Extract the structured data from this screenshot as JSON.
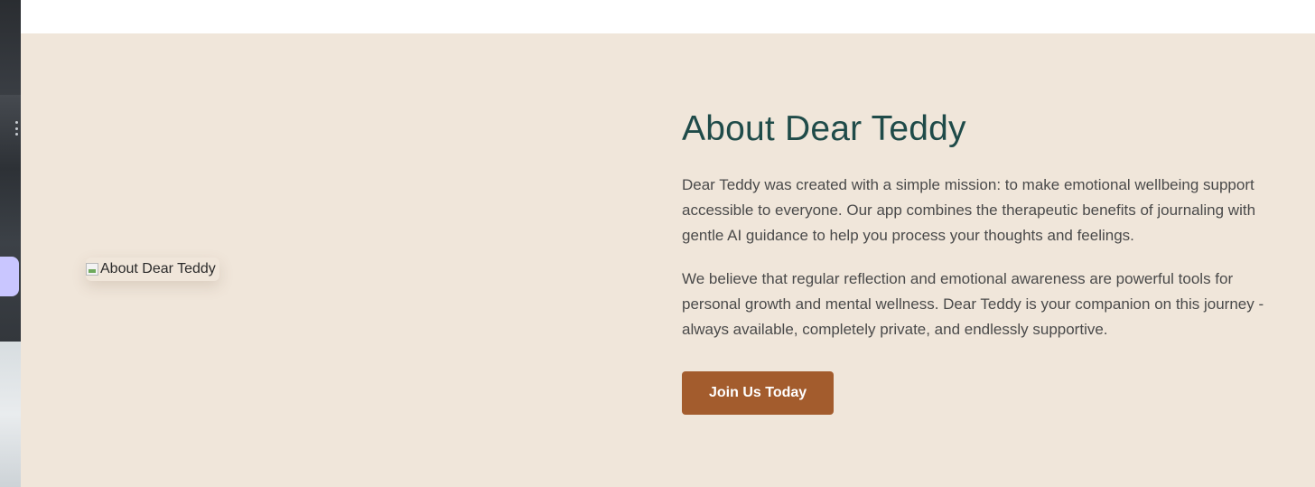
{
  "about": {
    "image_alt": "About Dear Teddy",
    "title": "About Dear Teddy",
    "paragraph_1": "Dear Teddy was created with a simple mission: to make emotional wellbeing support accessible to everyone. Our app combines the therapeutic benefits of journaling with gentle AI guidance to help you process your thoughts and feelings.",
    "paragraph_2": "We believe that regular reflection and emotional awareness are powerful tools for personal growth and mental wellness. Dear Teddy is your companion on this journey - always available, completely private, and endlessly supportive.",
    "cta_label": "Join Us Today"
  },
  "colors": {
    "section_background": "#f0e6da",
    "title": "#1f4b49",
    "body_text": "#4a4a4a",
    "button": "#a35c2d"
  },
  "icons": {
    "broken_image": "broken-image-icon",
    "kebab": "kebab-menu-icon"
  }
}
